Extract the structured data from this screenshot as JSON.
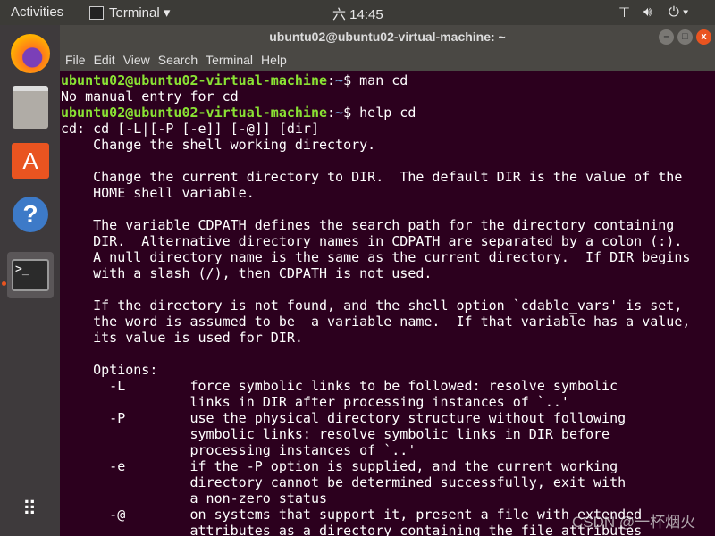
{
  "topbar": {
    "activities": "Activities",
    "app": "Terminal",
    "clock": "六 14:45"
  },
  "window": {
    "title": "ubuntu02@ubuntu02-virtual-machine: ~"
  },
  "menu": [
    "File",
    "Edit",
    "View",
    "Search",
    "Terminal",
    "Help"
  ],
  "dock": [
    "firefox-icon",
    "files-icon",
    "software-icon",
    "help-icon",
    "terminal-icon",
    "apps-grid-icon"
  ],
  "terminal": {
    "prompt_user": "ubuntu02@ubuntu02-virtual-machine",
    "prompt_dir": "~",
    "cmd1": "man cd",
    "out1": "No manual entry for cd",
    "cmd2": "help cd",
    "lines": [
      "cd: cd [-L|[-P [-e]] [-@]] [dir]",
      "    Change the shell working directory.",
      "",
      "    Change the current directory to DIR.  The default DIR is the value of the",
      "    HOME shell variable.",
      "",
      "    The variable CDPATH defines the search path for the directory containing",
      "    DIR.  Alternative directory names in CDPATH are separated by a colon (:).",
      "    A null directory name is the same as the current directory.  If DIR begins",
      "    with a slash (/), then CDPATH is not used.",
      "",
      "    If the directory is not found, and the shell option `cdable_vars' is set,",
      "    the word is assumed to be  a variable name.  If that variable has a value,",
      "    its value is used for DIR.",
      "",
      "    Options:",
      "      -L        force symbolic links to be followed: resolve symbolic",
      "                links in DIR after processing instances of `..'",
      "      -P        use the physical directory structure without following",
      "                symbolic links: resolve symbolic links in DIR before",
      "                processing instances of `..'",
      "      -e        if the -P option is supplied, and the current working",
      "                directory cannot be determined successfully, exit with",
      "                a non-zero status",
      "      -@        on systems that support it, present a file with extended",
      "                attributes as a directory containing the file attributes"
    ]
  },
  "watermark": "CSDN @一杯烟火"
}
